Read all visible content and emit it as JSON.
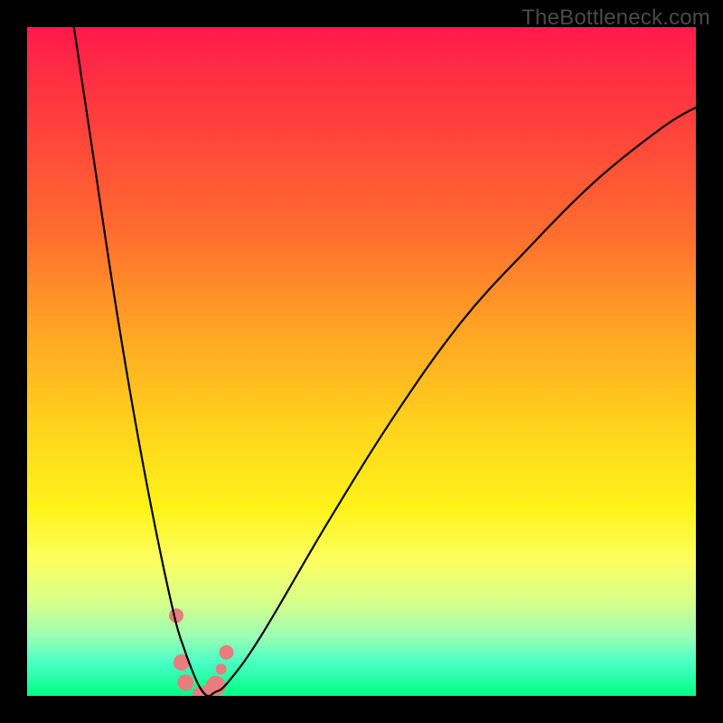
{
  "watermark": "TheBottleneck.com",
  "chart_data": {
    "type": "line",
    "title": "",
    "xlabel": "",
    "ylabel": "",
    "xlim": [
      0,
      100
    ],
    "ylim": [
      0,
      100
    ],
    "grid": false,
    "legend": false,
    "series": [
      {
        "name": "bottleneck-curve",
        "x": [
          7,
          10,
          13,
          16,
          19,
          22,
          23.5,
          25,
          26,
          27,
          28,
          30,
          35,
          45,
          55,
          65,
          75,
          85,
          95,
          100
        ],
        "y": [
          100,
          80,
          60,
          42,
          26,
          12,
          7,
          3,
          1,
          0,
          0.5,
          2,
          9,
          26,
          42,
          56,
          67,
          77,
          85,
          88
        ]
      }
    ],
    "markers": {
      "comment": "salmon dots near curve minimum",
      "color": "#e77d7d",
      "points": [
        {
          "x": 22.3,
          "y": 12.0,
          "r": 8
        },
        {
          "x": 23.1,
          "y": 5.0,
          "r": 9
        },
        {
          "x": 23.7,
          "y": 2.0,
          "r": 9
        },
        {
          "x": 25.8,
          "y": 0.3,
          "r": 8
        },
        {
          "x": 27.0,
          "y": 0.3,
          "r": 10
        },
        {
          "x": 28.2,
          "y": 1.5,
          "r": 11
        },
        {
          "x": 29.0,
          "y": 4.0,
          "r": 6
        },
        {
          "x": 29.8,
          "y": 6.5,
          "r": 8
        }
      ]
    }
  }
}
